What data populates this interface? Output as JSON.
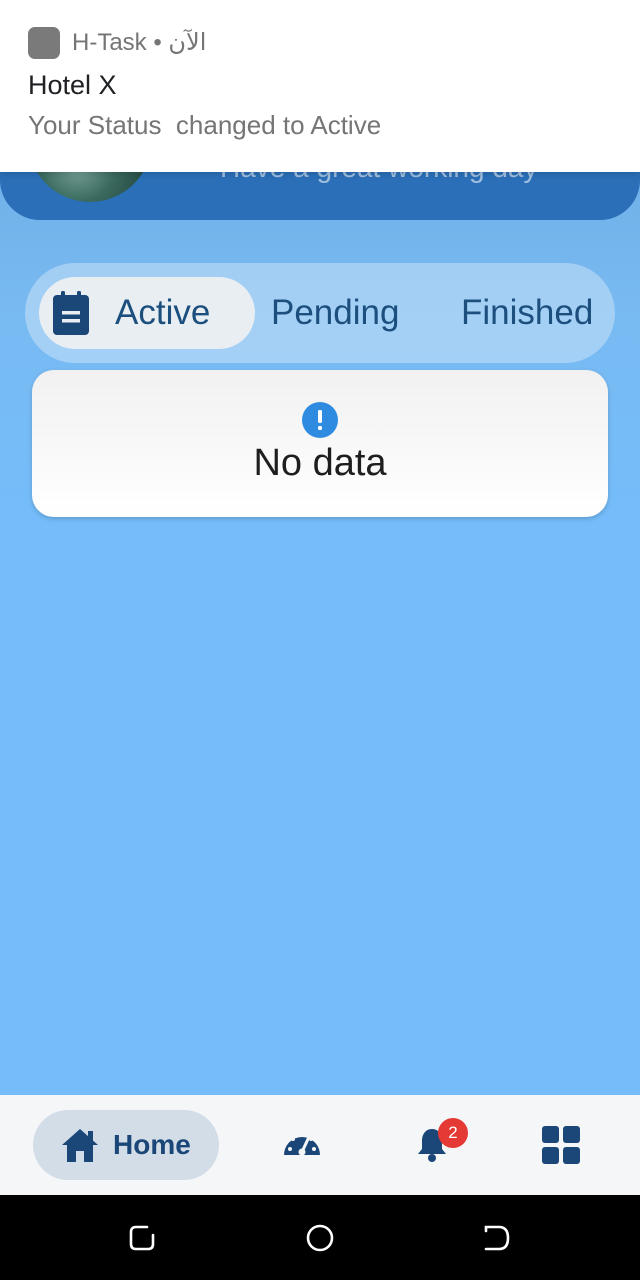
{
  "notification": {
    "app_name": "H-Task",
    "time": "الآن",
    "title": "Hotel X",
    "body": "Your Status  changed to Active"
  },
  "header": {
    "greeting": "Have a great working day"
  },
  "tabs": [
    {
      "label": "Active",
      "icon": "clipboard-icon",
      "selected": true
    },
    {
      "label": "Pending",
      "selected": false
    },
    {
      "label": "Finished",
      "selected": false
    }
  ],
  "empty_state": {
    "icon": "exclamation-icon",
    "text": "No data"
  },
  "bottom_nav": {
    "home_label": "Home",
    "notification_count": "2",
    "items": [
      "home-icon",
      "dashboard-icon",
      "bell-icon",
      "grid-icon"
    ]
  },
  "colors": {
    "primary_dark": "#1b4778",
    "header_blue": "#2a6fb8",
    "background_blue": "#74bdfa",
    "badge_red": "#e53935",
    "info_blue": "#2f8be0"
  }
}
